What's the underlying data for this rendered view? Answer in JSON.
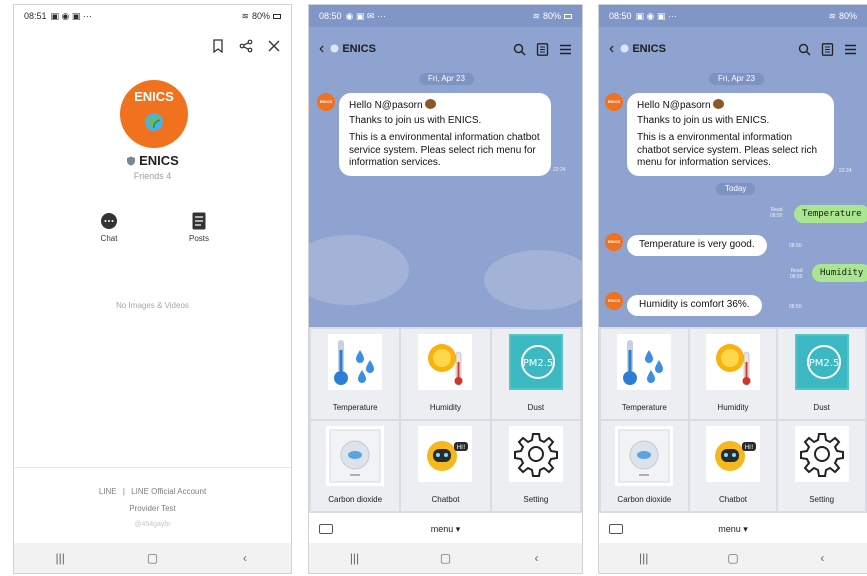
{
  "phones": [
    {
      "status": {
        "time": "08:51",
        "battery": "80%"
      },
      "profile": {
        "logo_text": "ENICS",
        "name": "ENICS",
        "friends": "Friends 4",
        "actions": [
          {
            "label": "Chat"
          },
          {
            "label": "Posts"
          }
        ],
        "empty_text": "No Images & Videos",
        "footer": {
          "brand": "LINE",
          "separator": "|",
          "account_type": "LINE Official Account",
          "provider": "Provider Test",
          "handle": "@454gaybr"
        }
      }
    },
    {
      "status": {
        "time": "08:50",
        "battery": "80%"
      },
      "chat": {
        "title": "ENICS",
        "date_label": "Fri, Apr 23",
        "welcome": {
          "line1": "Hello N@pasorn",
          "line2": "Thanks to join us with ENICS.",
          "line3": "This is a environmental information chatbot service system. Pleas select rich menu for information services.",
          "time": "22:24"
        }
      }
    },
    {
      "status": {
        "time": "08:50",
        "battery": "80%"
      },
      "chat": {
        "title": "ENICS",
        "date_label": "Fri, Apr 23",
        "welcome": {
          "line1": "Hello N@pasorn",
          "line2": "Thanks to join us with ENICS.",
          "line3": "This is a environmental information chatbot service system. Pleas select rich menu for information services.",
          "time": "22:24"
        },
        "today_label": "Today",
        "messages": [
          {
            "from": "me",
            "text": "Temperature",
            "read": "Read",
            "time": "08:50"
          },
          {
            "from": "bot",
            "text": "Temperature is very good.",
            "time": "08:50"
          },
          {
            "from": "me",
            "text": "Humidity",
            "read": "Read",
            "time": "08:50"
          },
          {
            "from": "bot",
            "text": "Humidity is comfort 36%.",
            "time": "08:50"
          }
        ]
      }
    }
  ],
  "rich_menu": [
    {
      "label": "Temperature",
      "icon": "thermometer-icon"
    },
    {
      "label": "Humidity",
      "icon": "sun-thermometer-icon"
    },
    {
      "label": "Dust",
      "icon": "pm25-icon",
      "badge": "PM2.5"
    },
    {
      "label": "Carbon dioxide",
      "icon": "co2-sensor-icon"
    },
    {
      "label": "Chatbot",
      "icon": "robot-icon",
      "badge": "HI!"
    },
    {
      "label": "Setting",
      "icon": "gear-icon"
    }
  ],
  "menubar_label": "menu ▾",
  "nav_icons": [
    "recent-apps-icon",
    "home-icon",
    "back-icon"
  ],
  "colors": {
    "brand_orange": "#f0711e",
    "chat_bg": "#8ea3cf",
    "sent_bubble": "#a9e68f"
  }
}
